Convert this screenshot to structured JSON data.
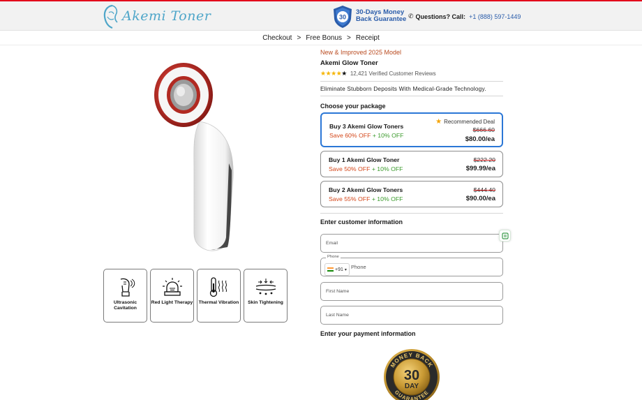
{
  "header": {
    "brand": "Akemi Toner",
    "guarantee_line1": "30-Days Money",
    "guarantee_line2": "Back Guarantee",
    "guarantee_badge": "30",
    "questions_label": "Questions? Call:",
    "phone_number": "+1 (888) 597-1449"
  },
  "breadcrumb": {
    "items": [
      "Checkout",
      "Free Bonus",
      "Receipt"
    ],
    "separator": ">"
  },
  "product": {
    "model_label": "New & Improved 2025 Model",
    "name": "Akemi Glow Toner",
    "rating": 4.5,
    "reviews_text": "12,421 Verified Customer Reviews",
    "tagline": "Eliminate Stubborn Deposits With Medical-Grade Technology."
  },
  "features": [
    {
      "icon": "ultrasonic-icon",
      "label": "Ultrasonic Cavitation"
    },
    {
      "icon": "red-light-icon",
      "label": "Red Light Therapy"
    },
    {
      "icon": "thermal-icon",
      "label": "Thermal Vibration"
    },
    {
      "icon": "skin-tightening-icon",
      "label": "Skin Tightening"
    }
  ],
  "packages_heading": "Choose your package",
  "packages": [
    {
      "title": "Buy 3 Akemi Glow Toners",
      "save": "Save 60% OFF",
      "extra": "+ 10% OFF",
      "old_price": "$666.60",
      "price": "$80.00/ea",
      "badge": "Recommended Deal",
      "selected": true
    },
    {
      "title": "Buy 1 Akemi Glow Toner",
      "save": "Save 50% OFF",
      "extra": "+ 10% OFF",
      "old_price": "$222.20",
      "price": "$99.99/ea",
      "selected": false
    },
    {
      "title": "Buy 2 Akemi Glow Toners",
      "save": "Save 55% OFF",
      "extra": "+ 10% OFF",
      "old_price": "$444.40",
      "price": "$90.00/ea",
      "selected": false
    }
  ],
  "customer": {
    "heading": "Enter customer information",
    "email_placeholder": "Email",
    "phone_label": "Phone",
    "country_code": "+91",
    "phone_placeholder": "Phone",
    "first_name_placeholder": "First Name",
    "last_name_placeholder": "Last Name"
  },
  "payment": {
    "heading": "Enter your payment information"
  },
  "seal": {
    "top_text": "MONEY BACK",
    "number": "30",
    "day": "DAY",
    "bottom_text": "GUARANTEE"
  },
  "colors": {
    "accent_red": "#e3001b",
    "link_blue": "#2a5caa",
    "selected_border": "#2b77d6",
    "save_orange": "#d4471a",
    "extra_green": "#3a9a2b",
    "star": "#f5b400"
  }
}
